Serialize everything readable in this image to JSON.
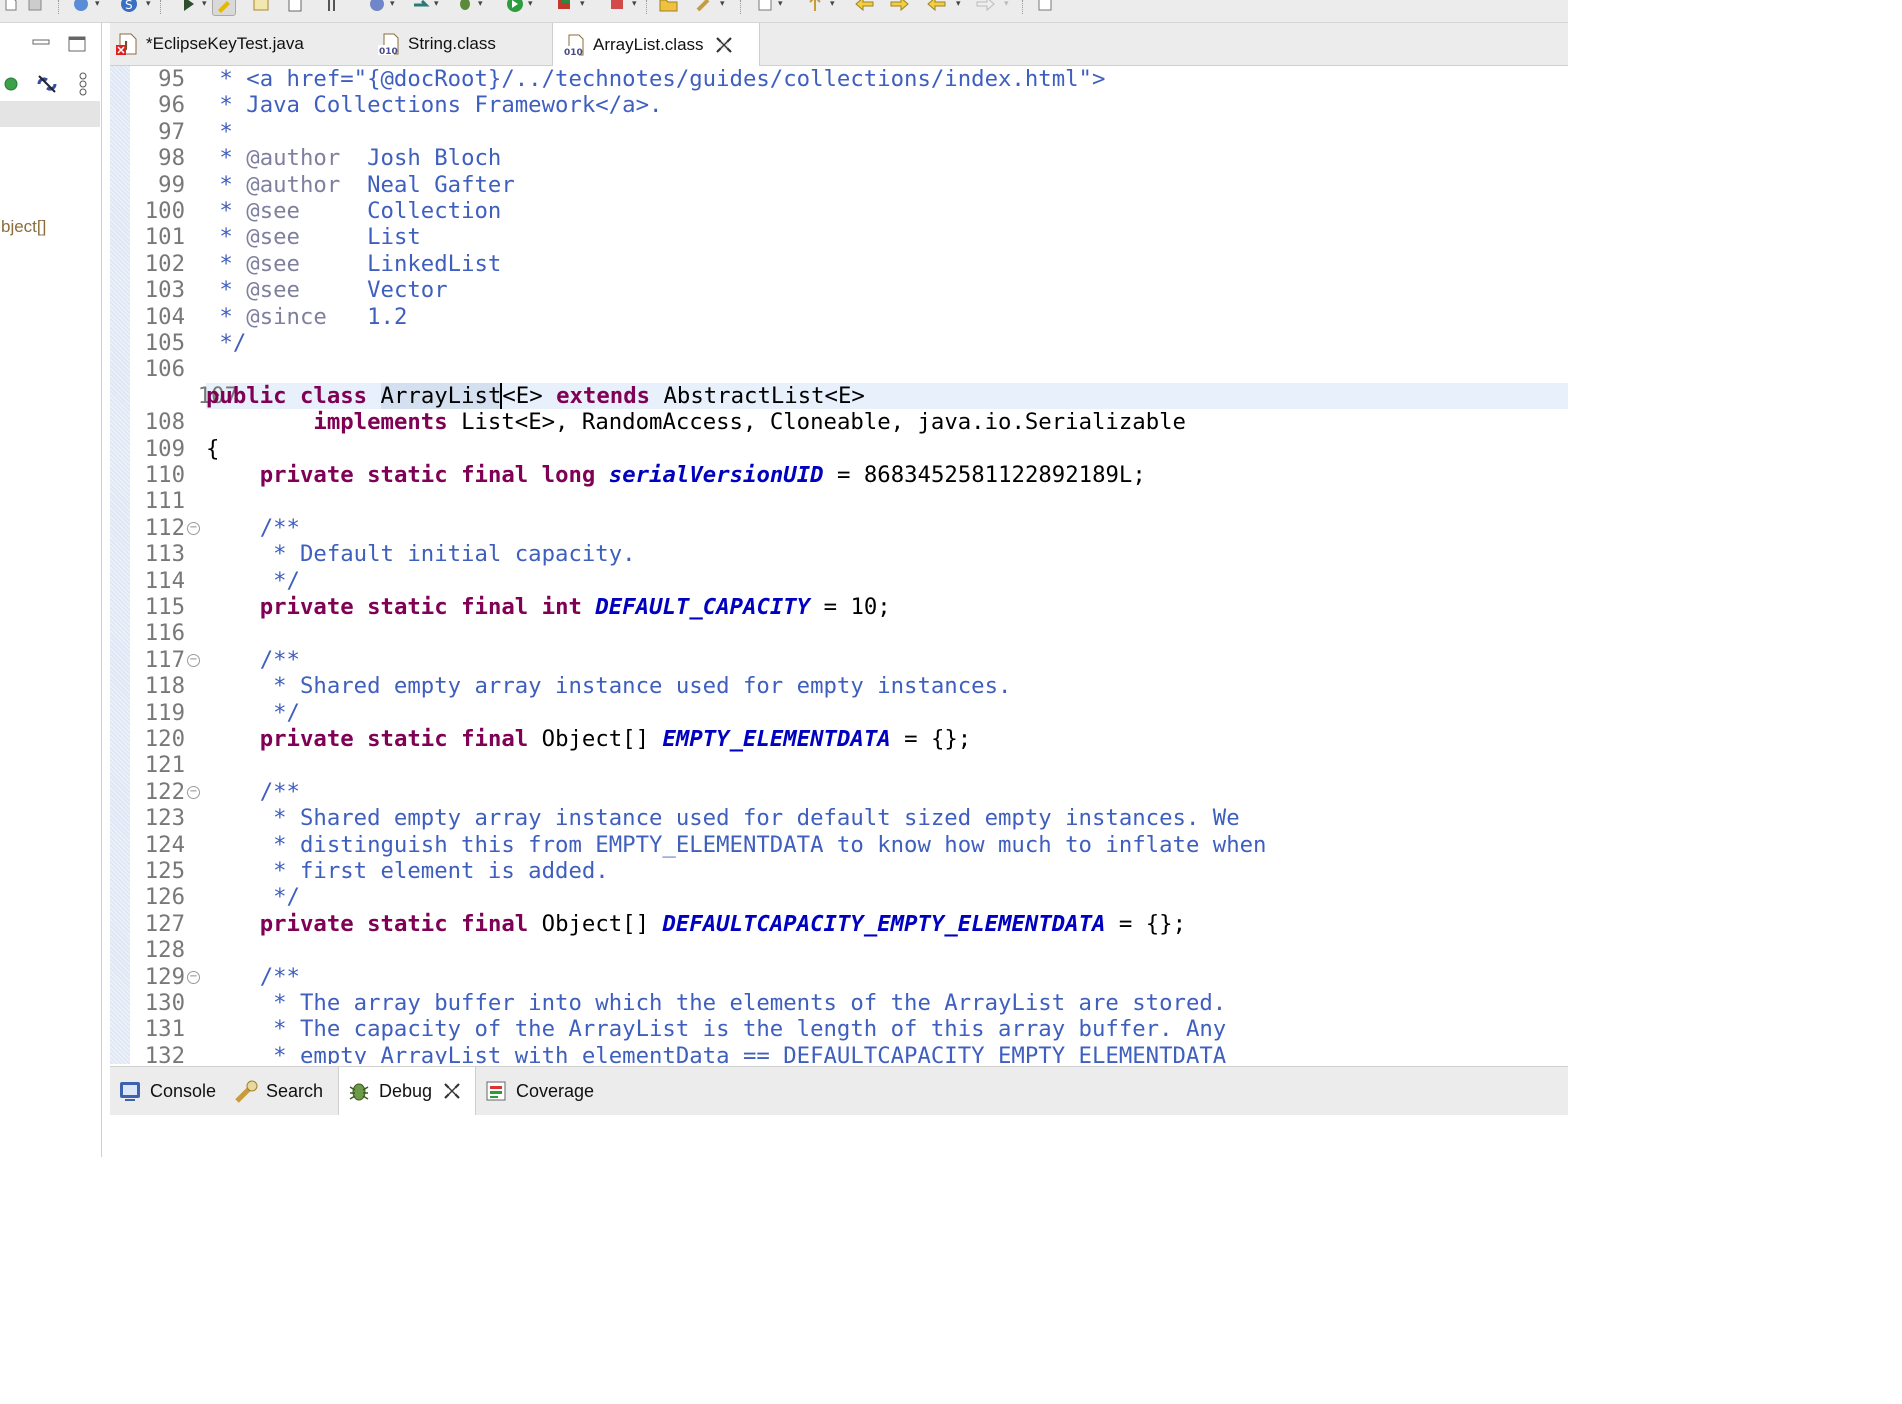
{
  "toolbar": {
    "icons": [
      "new-icon",
      "save-icon",
      "print-icon",
      "open-type-icon",
      "debug-icon",
      "highlight-icon",
      "open-task-icon",
      "outline-icon",
      "pin-icon",
      "web-icon",
      "launch-icon",
      "bug-icon",
      "run-icon",
      "coverage-icon",
      "external-tools-icon",
      "open-folder-icon",
      "search-icon",
      "previous-annotation-icon",
      "next-annotation-icon",
      "back-icon",
      "forward-icon",
      "last-edit-icon",
      "perspective-icon"
    ]
  },
  "left_panel": {
    "truncated_label": "bject[]",
    "icons": [
      "minimize-icon",
      "maximize-icon",
      "status-dot-icon",
      "link-editor-icon",
      "view-menu-icon"
    ]
  },
  "editor_tabs": [
    {
      "label": "*EclipseKeyTest.java",
      "icon": "java-file-error-icon",
      "active": false
    },
    {
      "label": "String.class",
      "icon": "class-file-icon",
      "active": false
    },
    {
      "label": "ArrayList.class",
      "icon": "class-file-icon",
      "active": true,
      "close": "close-icon"
    }
  ],
  "editor": {
    "colors": {
      "keyword": "#7f0055",
      "javadoc": "#3f5fbf",
      "javadoc_tag": "#7f7f9f",
      "static_field": "#0000c0",
      "line_number": "#787878",
      "current_line": "#e8f0fb"
    },
    "lines": [
      {
        "n": "95",
        "parts": [
          [
            "cm",
            " * <a href=\"{@docRoot}/../technotes/guides/collections/index.html\">"
          ]
        ]
      },
      {
        "n": "96",
        "parts": [
          [
            "cm",
            " * Java Collections Framework</a>."
          ]
        ]
      },
      {
        "n": "97",
        "parts": [
          [
            "cm",
            " *"
          ]
        ]
      },
      {
        "n": "98",
        "parts": [
          [
            "cm",
            " * "
          ],
          [
            "tag",
            "@author"
          ],
          [
            "cm",
            "  Josh Bloch"
          ]
        ]
      },
      {
        "n": "99",
        "parts": [
          [
            "cm",
            " * "
          ],
          [
            "tag",
            "@author"
          ],
          [
            "cm",
            "  Neal Gafter"
          ]
        ]
      },
      {
        "n": "100",
        "parts": [
          [
            "cm",
            " * "
          ],
          [
            "tag",
            "@see"
          ],
          [
            "cm",
            "     Collection"
          ]
        ]
      },
      {
        "n": "101",
        "parts": [
          [
            "cm",
            " * "
          ],
          [
            "tag",
            "@see"
          ],
          [
            "cm",
            "     List"
          ]
        ]
      },
      {
        "n": "102",
        "parts": [
          [
            "cm",
            " * "
          ],
          [
            "tag",
            "@see"
          ],
          [
            "cm",
            "     LinkedList"
          ]
        ]
      },
      {
        "n": "103",
        "parts": [
          [
            "cm",
            " * "
          ],
          [
            "tag",
            "@see"
          ],
          [
            "cm",
            "     Vector"
          ]
        ]
      },
      {
        "n": "104",
        "parts": [
          [
            "cm",
            " * "
          ],
          [
            "tag",
            "@since"
          ],
          [
            "cm",
            "   1.2"
          ]
        ]
      },
      {
        "n": "105",
        "parts": [
          [
            "cm",
            " */"
          ]
        ]
      },
      {
        "n": "106",
        "parts": []
      },
      {
        "n": "107",
        "current": true,
        "parts": [
          [
            "kw",
            "public"
          ],
          [
            "pl",
            " "
          ],
          [
            "kw",
            "class"
          ],
          [
            "pl",
            " "
          ],
          [
            "occ",
            "ArrayList"
          ],
          [
            "caret",
            ""
          ],
          [
            "pl",
            "<E> "
          ],
          [
            "kw",
            "extends"
          ],
          [
            "pl",
            " AbstractList<E>"
          ]
        ]
      },
      {
        "n": "108",
        "parts": [
          [
            "pl",
            "        "
          ],
          [
            "kw",
            "implements"
          ],
          [
            "pl",
            " List<E>, RandomAccess, Cloneable, java.io.Serializable"
          ]
        ]
      },
      {
        "n": "109",
        "parts": [
          [
            "pl",
            "{"
          ]
        ]
      },
      {
        "n": "110",
        "parts": [
          [
            "pl",
            "    "
          ],
          [
            "kw",
            "private"
          ],
          [
            "pl",
            " "
          ],
          [
            "kw",
            "static"
          ],
          [
            "pl",
            " "
          ],
          [
            "kw",
            "final"
          ],
          [
            "pl",
            " "
          ],
          [
            "kw",
            "long"
          ],
          [
            "pl",
            " "
          ],
          [
            "fld",
            "serialVersionUID"
          ],
          [
            "pl",
            " = 8683452581122892189L;"
          ]
        ]
      },
      {
        "n": "111",
        "parts": []
      },
      {
        "n": "112",
        "fold": true,
        "parts": [
          [
            "pl",
            "    "
          ],
          [
            "cm",
            "/**"
          ]
        ]
      },
      {
        "n": "113",
        "parts": [
          [
            "cm",
            "     * Default initial capacity."
          ]
        ]
      },
      {
        "n": "114",
        "parts": [
          [
            "cm",
            "     */"
          ]
        ]
      },
      {
        "n": "115",
        "parts": [
          [
            "pl",
            "    "
          ],
          [
            "kw",
            "private"
          ],
          [
            "pl",
            " "
          ],
          [
            "kw",
            "static"
          ],
          [
            "pl",
            " "
          ],
          [
            "kw",
            "final"
          ],
          [
            "pl",
            " "
          ],
          [
            "kw",
            "int"
          ],
          [
            "pl",
            " "
          ],
          [
            "fld",
            "DEFAULT_CAPACITY"
          ],
          [
            "pl",
            " = 10;"
          ]
        ]
      },
      {
        "n": "116",
        "parts": []
      },
      {
        "n": "117",
        "fold": true,
        "parts": [
          [
            "pl",
            "    "
          ],
          [
            "cm",
            "/**"
          ]
        ]
      },
      {
        "n": "118",
        "parts": [
          [
            "cm",
            "     * Shared empty array instance used for empty instances."
          ]
        ]
      },
      {
        "n": "119",
        "parts": [
          [
            "cm",
            "     */"
          ]
        ]
      },
      {
        "n": "120",
        "parts": [
          [
            "pl",
            "    "
          ],
          [
            "kw",
            "private"
          ],
          [
            "pl",
            " "
          ],
          [
            "kw",
            "static"
          ],
          [
            "pl",
            " "
          ],
          [
            "kw",
            "final"
          ],
          [
            "pl",
            " Object[] "
          ],
          [
            "fld",
            "EMPTY_ELEMENTDATA"
          ],
          [
            "pl",
            " = {};"
          ]
        ]
      },
      {
        "n": "121",
        "parts": []
      },
      {
        "n": "122",
        "fold": true,
        "parts": [
          [
            "pl",
            "    "
          ],
          [
            "cm",
            "/**"
          ]
        ]
      },
      {
        "n": "123",
        "parts": [
          [
            "cm",
            "     * Shared empty array instance used for default sized empty instances. We"
          ]
        ]
      },
      {
        "n": "124",
        "parts": [
          [
            "cm",
            "     * distinguish this from EMPTY_ELEMENTDATA to know how much to inflate when"
          ]
        ]
      },
      {
        "n": "125",
        "parts": [
          [
            "cm",
            "     * first element is added."
          ]
        ]
      },
      {
        "n": "126",
        "parts": [
          [
            "cm",
            "     */"
          ]
        ]
      },
      {
        "n": "127",
        "parts": [
          [
            "pl",
            "    "
          ],
          [
            "kw",
            "private"
          ],
          [
            "pl",
            " "
          ],
          [
            "kw",
            "static"
          ],
          [
            "pl",
            " "
          ],
          [
            "kw",
            "final"
          ],
          [
            "pl",
            " Object[] "
          ],
          [
            "fld",
            "DEFAULTCAPACITY_EMPTY_ELEMENTDATA"
          ],
          [
            "pl",
            " = {};"
          ]
        ]
      },
      {
        "n": "128",
        "parts": []
      },
      {
        "n": "129",
        "fold": true,
        "parts": [
          [
            "pl",
            "    "
          ],
          [
            "cm",
            "/**"
          ]
        ]
      },
      {
        "n": "130",
        "parts": [
          [
            "cm",
            "     * The array buffer into which the elements of the ArrayList are stored."
          ]
        ]
      },
      {
        "n": "131",
        "parts": [
          [
            "cm",
            "     * The capacity of the ArrayList is the length of this array buffer. Any"
          ]
        ]
      },
      {
        "n": "132",
        "parts": [
          [
            "cm",
            "     * empty ArrayList with elementData == DEFAULTCAPACITY_EMPTY_ELEMENTDATA"
          ]
        ]
      }
    ]
  },
  "bottom_tabs": [
    {
      "label": "Console",
      "icon": "console-icon",
      "active": false
    },
    {
      "label": "Search",
      "icon": "search-icon",
      "active": false
    },
    {
      "label": "Debug",
      "icon": "bug-icon",
      "active": true,
      "close": "close-icon"
    },
    {
      "label": "Coverage",
      "icon": "coverage-icon",
      "active": false
    }
  ]
}
